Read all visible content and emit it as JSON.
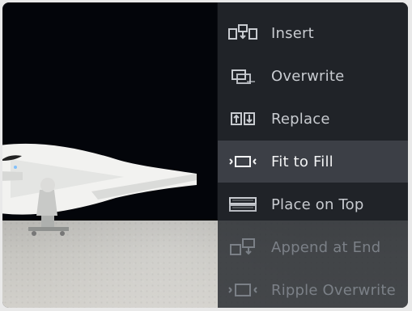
{
  "menu": {
    "items": [
      {
        "label": "Insert",
        "icon": "insert-icon",
        "state": "normal"
      },
      {
        "label": "Overwrite",
        "icon": "overwrite-icon",
        "state": "normal"
      },
      {
        "label": "Replace",
        "icon": "replace-icon",
        "state": "normal"
      },
      {
        "label": "Fit to Fill",
        "icon": "fit-to-fill-icon",
        "state": "selected"
      },
      {
        "label": "Place on Top",
        "icon": "place-on-top-icon",
        "state": "normal"
      },
      {
        "label": "Append at End",
        "icon": "append-at-end-icon",
        "state": "disabled"
      },
      {
        "label": "Ripple Overwrite",
        "icon": "ripple-overwrite-icon",
        "state": "disabled"
      }
    ]
  },
  "colors": {
    "menu_bg": "#262a2f",
    "menu_text": "#c8cbd0",
    "selected_bg": "#464b52",
    "selected_text": "#f2f3f4",
    "disabled_text": "#7b8087"
  }
}
